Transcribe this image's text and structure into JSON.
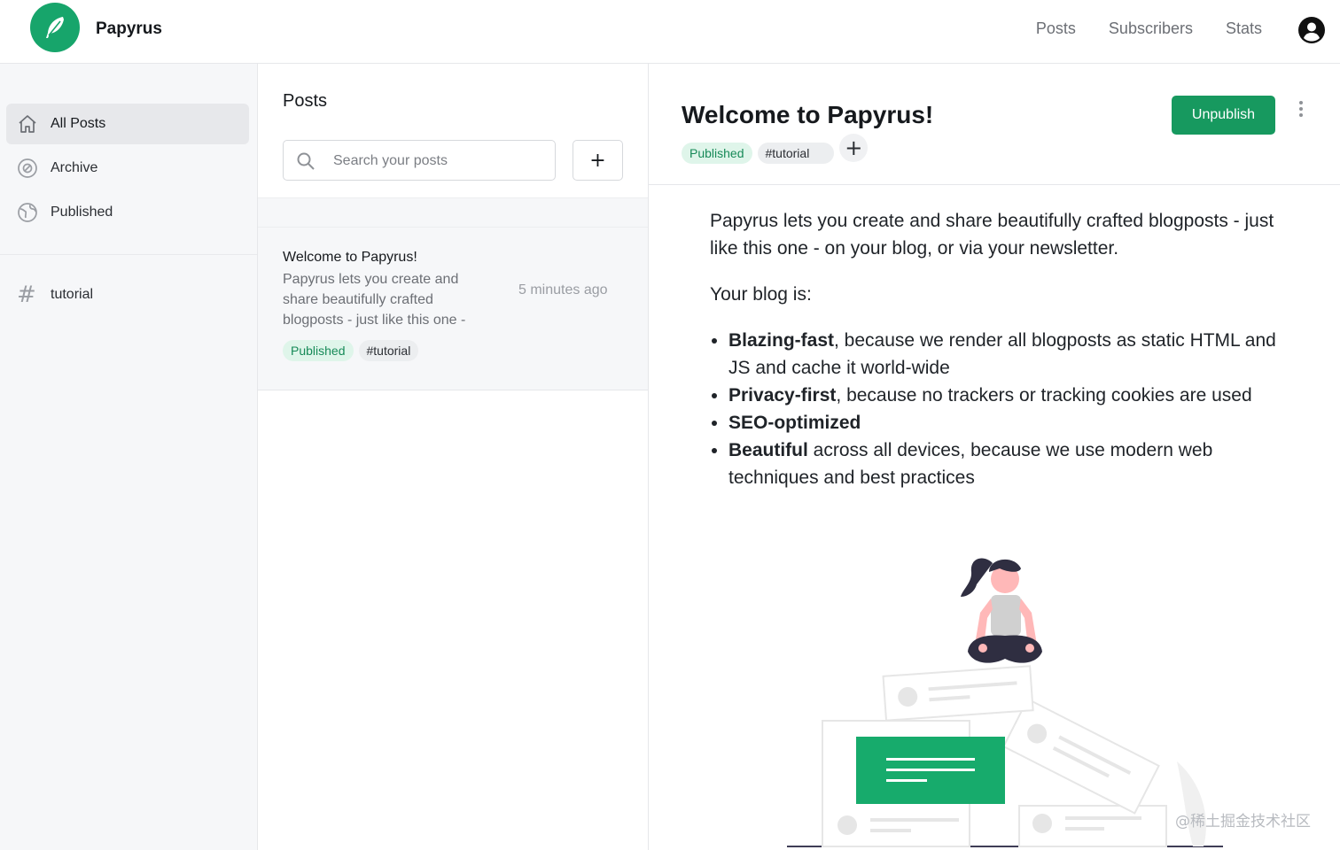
{
  "app": {
    "brand": "Papyrus",
    "accent": "#17a56b",
    "nav": [
      "Posts",
      "Subscribers",
      "Stats"
    ]
  },
  "sidebar": {
    "items": [
      {
        "label": "All Posts",
        "icon": "home-icon",
        "active": true
      },
      {
        "label": "Archive",
        "icon": "archive-icon",
        "active": false
      },
      {
        "label": "Published",
        "icon": "globe-icon",
        "active": false
      }
    ],
    "tags": [
      {
        "label": "tutorial",
        "icon": "hash-icon"
      }
    ]
  },
  "posts_panel": {
    "title": "Posts",
    "search_placeholder": "Search your posts",
    "add_label": "+",
    "posts": [
      {
        "title": "Welcome to Papyrus!",
        "excerpt": "Papyrus lets you create and share beautifully crafted blogposts - just like this one -",
        "time": "5 minutes ago",
        "status": "Published",
        "tag": "#tutorial"
      }
    ]
  },
  "editor": {
    "title": "Welcome to Papyrus!",
    "status": "Published",
    "tag": "#tutorial",
    "add_tag_label": "+",
    "unpublish_label": "Unpublish",
    "intro": "Papyrus lets you create and share beautifully crafted blogposts - just like this one - on your blog, or via your newsletter.",
    "blog_is": "Your blog is:",
    "bullets": [
      {
        "bold": "Blazing-fast",
        "rest": ", because we render all blogposts as static HTML and JS and cache it world-wide"
      },
      {
        "bold": "Privacy-first",
        "rest": ", because no trackers or tracking cookies are used"
      },
      {
        "bold": "SEO-optimized",
        "rest": ""
      },
      {
        "bold": "Beautiful",
        "rest": " across all devices, because we use modern web techniques and best practices"
      }
    ]
  },
  "watermark": "@稀土掘金技术社区"
}
